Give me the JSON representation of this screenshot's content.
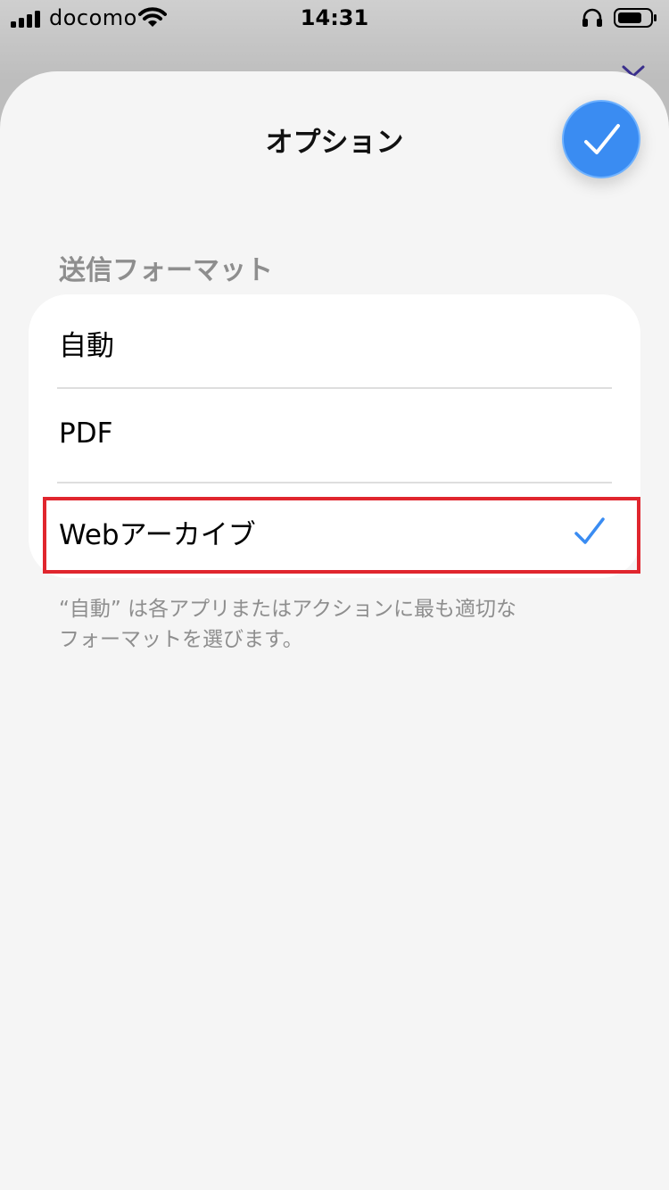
{
  "status_bar": {
    "carrier": "docomo",
    "time": "14:31",
    "signal_icon": "signal-bars-icon",
    "wifi_icon": "wifi-icon",
    "headphones_icon": "headphones-icon",
    "battery_icon": "battery-icon"
  },
  "sheet": {
    "title": "オプション",
    "done_icon": "checkmark-icon",
    "accent_color": "#3a8cf2"
  },
  "section": {
    "header": "送信フォーマット",
    "options": [
      {
        "label": "自動",
        "selected": false
      },
      {
        "label": "PDF",
        "selected": false
      },
      {
        "label": "Webアーカイブ",
        "selected": true
      }
    ],
    "footnote_line1": "“自動” は各アプリまたはアクションに最も適切な",
    "footnote_line2": "フォーマットを選びます。"
  },
  "highlight_color": "#e0262e"
}
